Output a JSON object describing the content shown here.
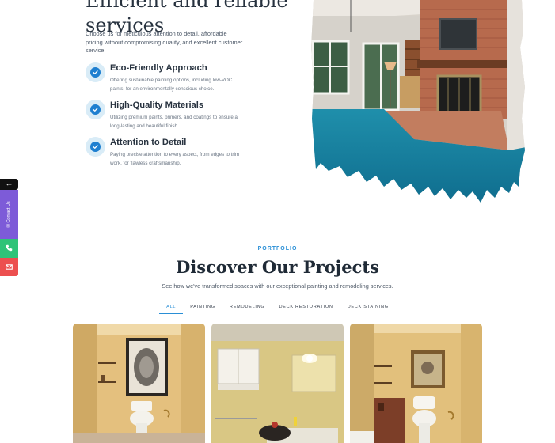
{
  "services": {
    "heading": "Efficient and reliable services",
    "description": "Choose us for meticulous attention to detail, affordable pricing without compromising quality, and excellent customer service.",
    "features": [
      {
        "title": "Eco-Friendly Approach",
        "text": "Offering sustainable painting options, including low-VOC paints, for an environmentally conscious choice.",
        "icon": "check-circle-icon"
      },
      {
        "title": "High-Quality Materials",
        "text": "Utilizing premium paints, primers, and coatings to ensure a long-lasting and beautiful finish.",
        "icon": "check-circle-icon"
      },
      {
        "title": "Attention to Detail",
        "text": "Paying precise attention to every aspect, from edges to trim work, for flawless craftsmanship.",
        "icon": "check-circle-icon"
      }
    ]
  },
  "side_bar": {
    "toggle_icon": "arrow-left-icon",
    "contact_label": "Contact Us",
    "phone_icon": "phone-icon",
    "mail_icon": "mail-icon",
    "colors": {
      "contact": "#7d5bd8",
      "phone": "#2fc378",
      "mail": "#ec4f4f"
    }
  },
  "portfolio": {
    "eyebrow": "PORTFOLIO",
    "title": "Discover Our Projects",
    "subtitle": "See how we've transformed spaces with our exceptional painting and remodeling services.",
    "tabs": [
      {
        "label": "ALL",
        "active": true
      },
      {
        "label": "PAINTING",
        "active": false
      },
      {
        "label": "REMODELING",
        "active": false
      },
      {
        "label": "DECK RESTORATION",
        "active": false
      },
      {
        "label": "DECK STAINING",
        "active": false
      }
    ]
  },
  "colors": {
    "accent": "#2a8fd6",
    "check": "#1e7fd0"
  }
}
